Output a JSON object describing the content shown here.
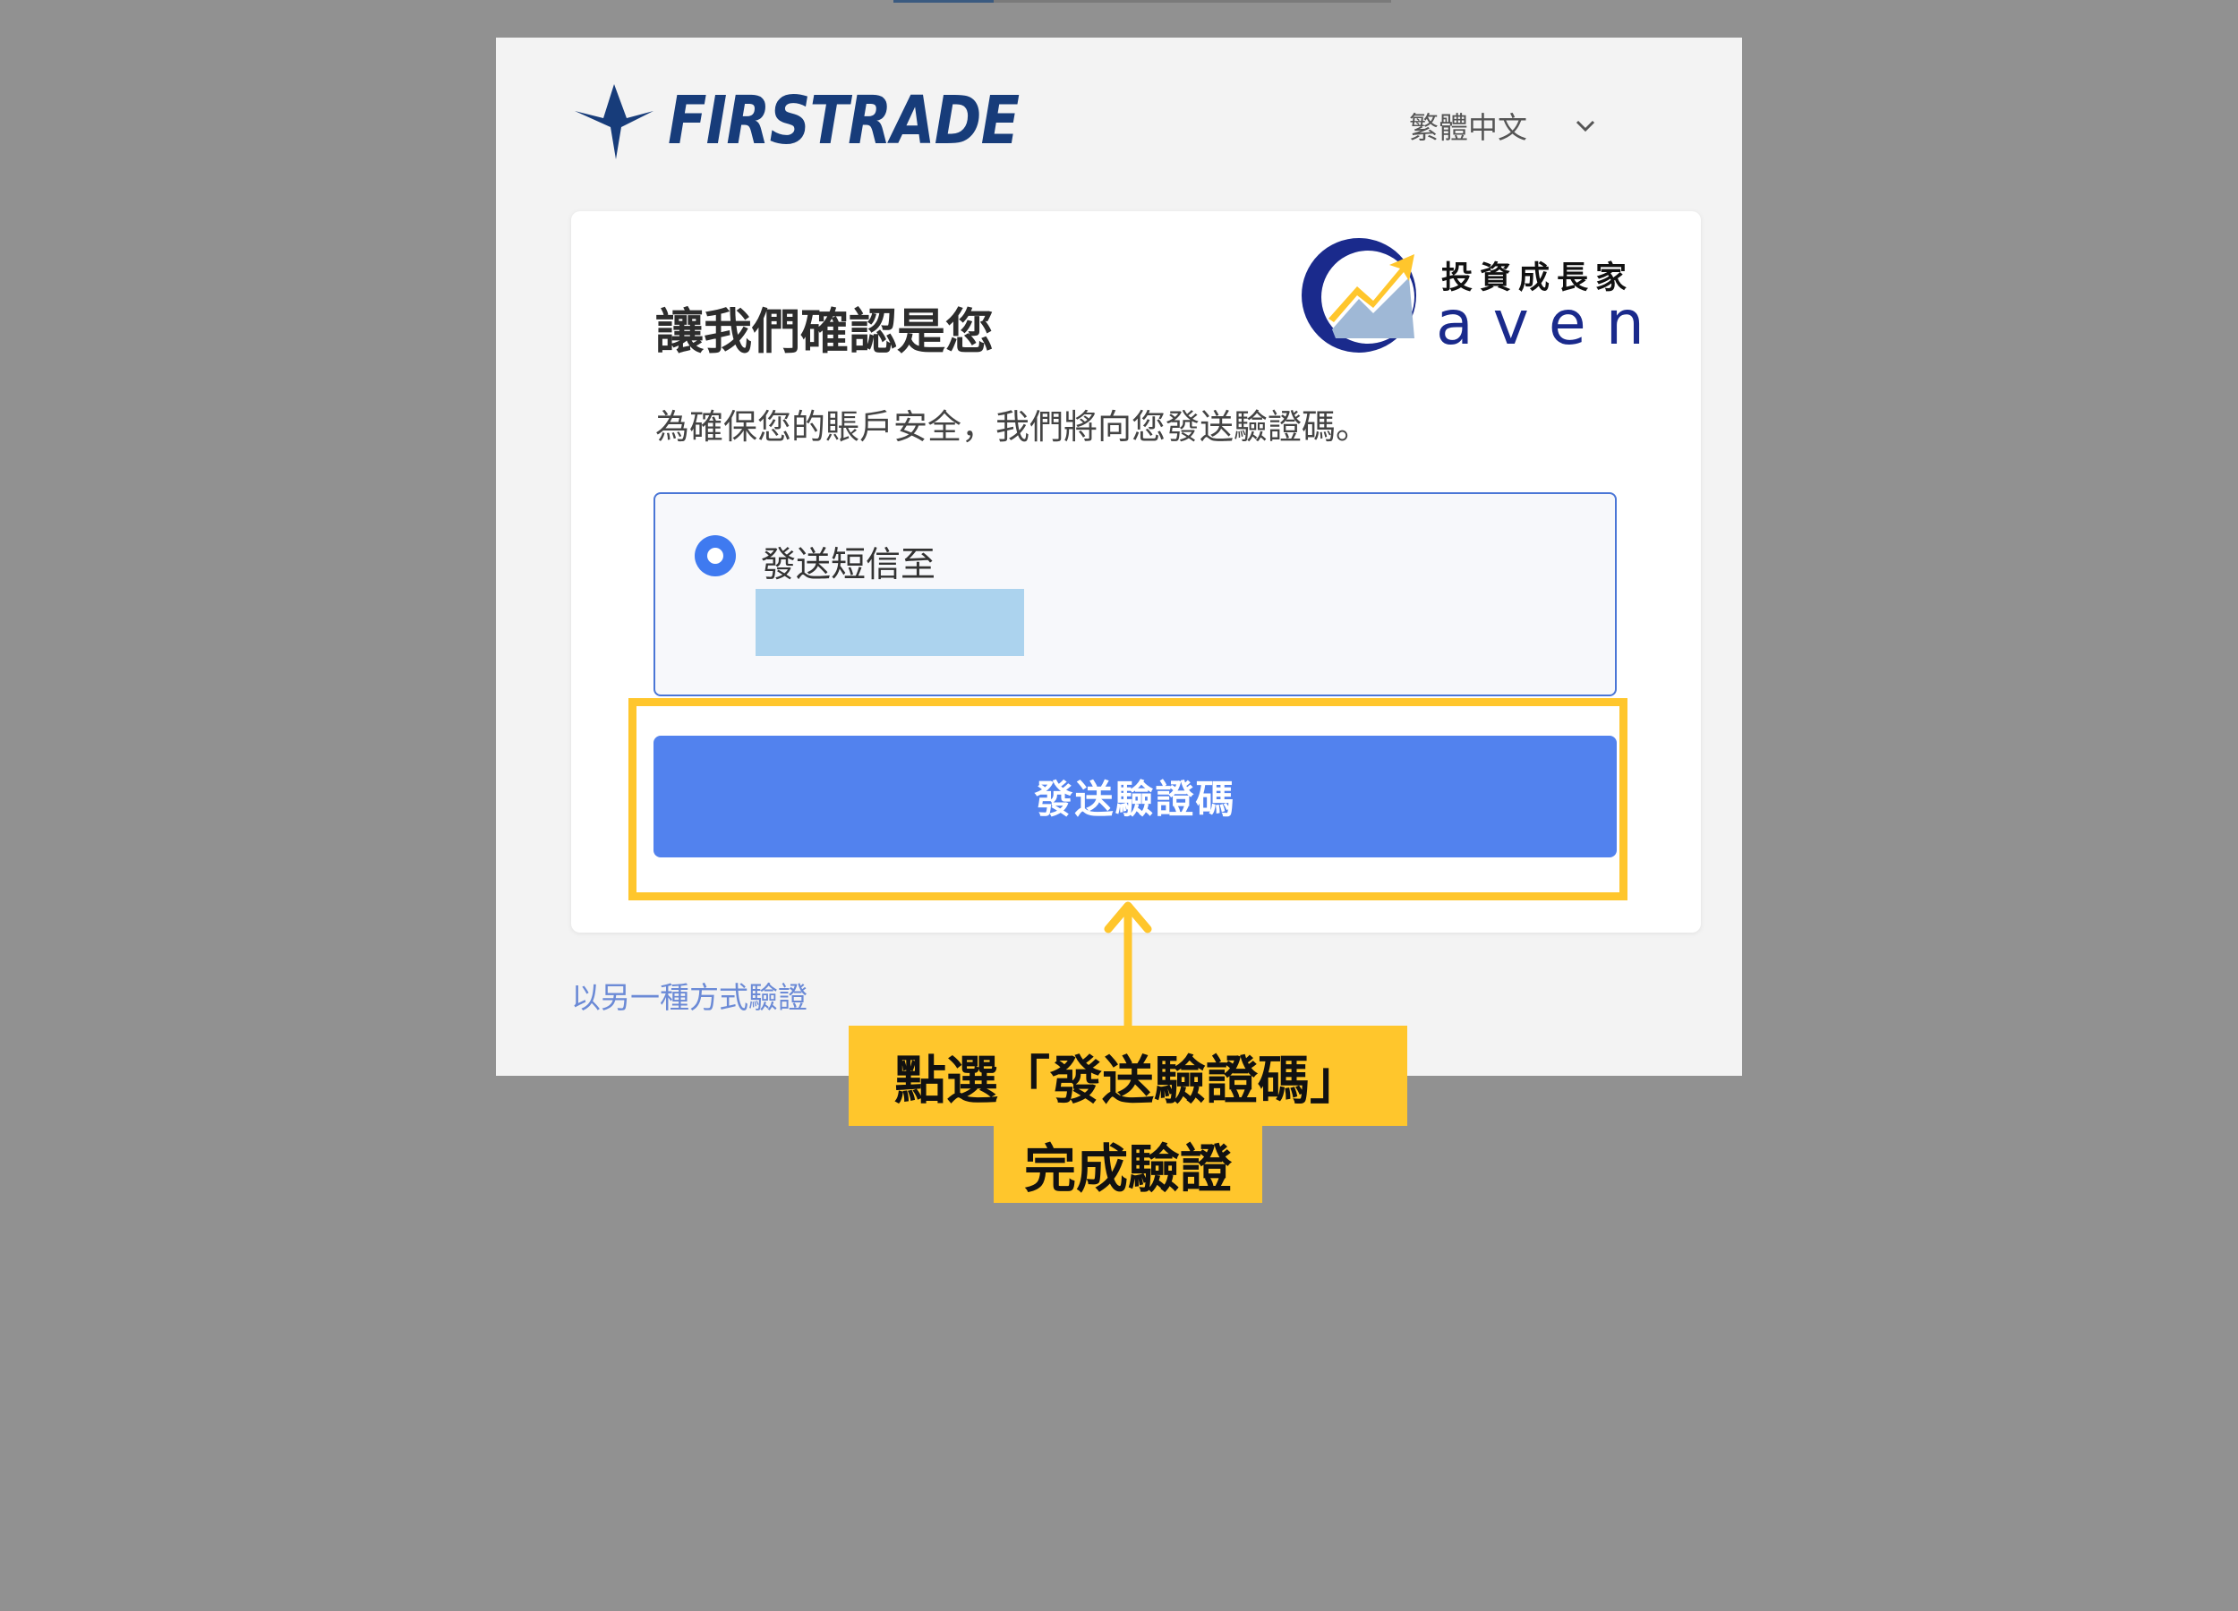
{
  "header": {
    "logo_text": "FIRSTRADE",
    "language_selected": "繁體中文"
  },
  "card": {
    "title": "讓我們確認是您",
    "description": "為確保您的賬戶安全，我們將向您發送驗證碼。",
    "option_label": "發送短信至",
    "send_button": "發送驗證碼"
  },
  "watermark": {
    "cn_text": "投資成長家",
    "en_text": "aven"
  },
  "alt_link": "以另一種方式驗證",
  "annotation": {
    "line1": "點選「發送驗證碼」",
    "line2": "完成驗證"
  },
  "colors": {
    "brand_navy": "#173c7a",
    "button_blue": "#5282ee",
    "highlight_yellow": "#ffc62c"
  }
}
